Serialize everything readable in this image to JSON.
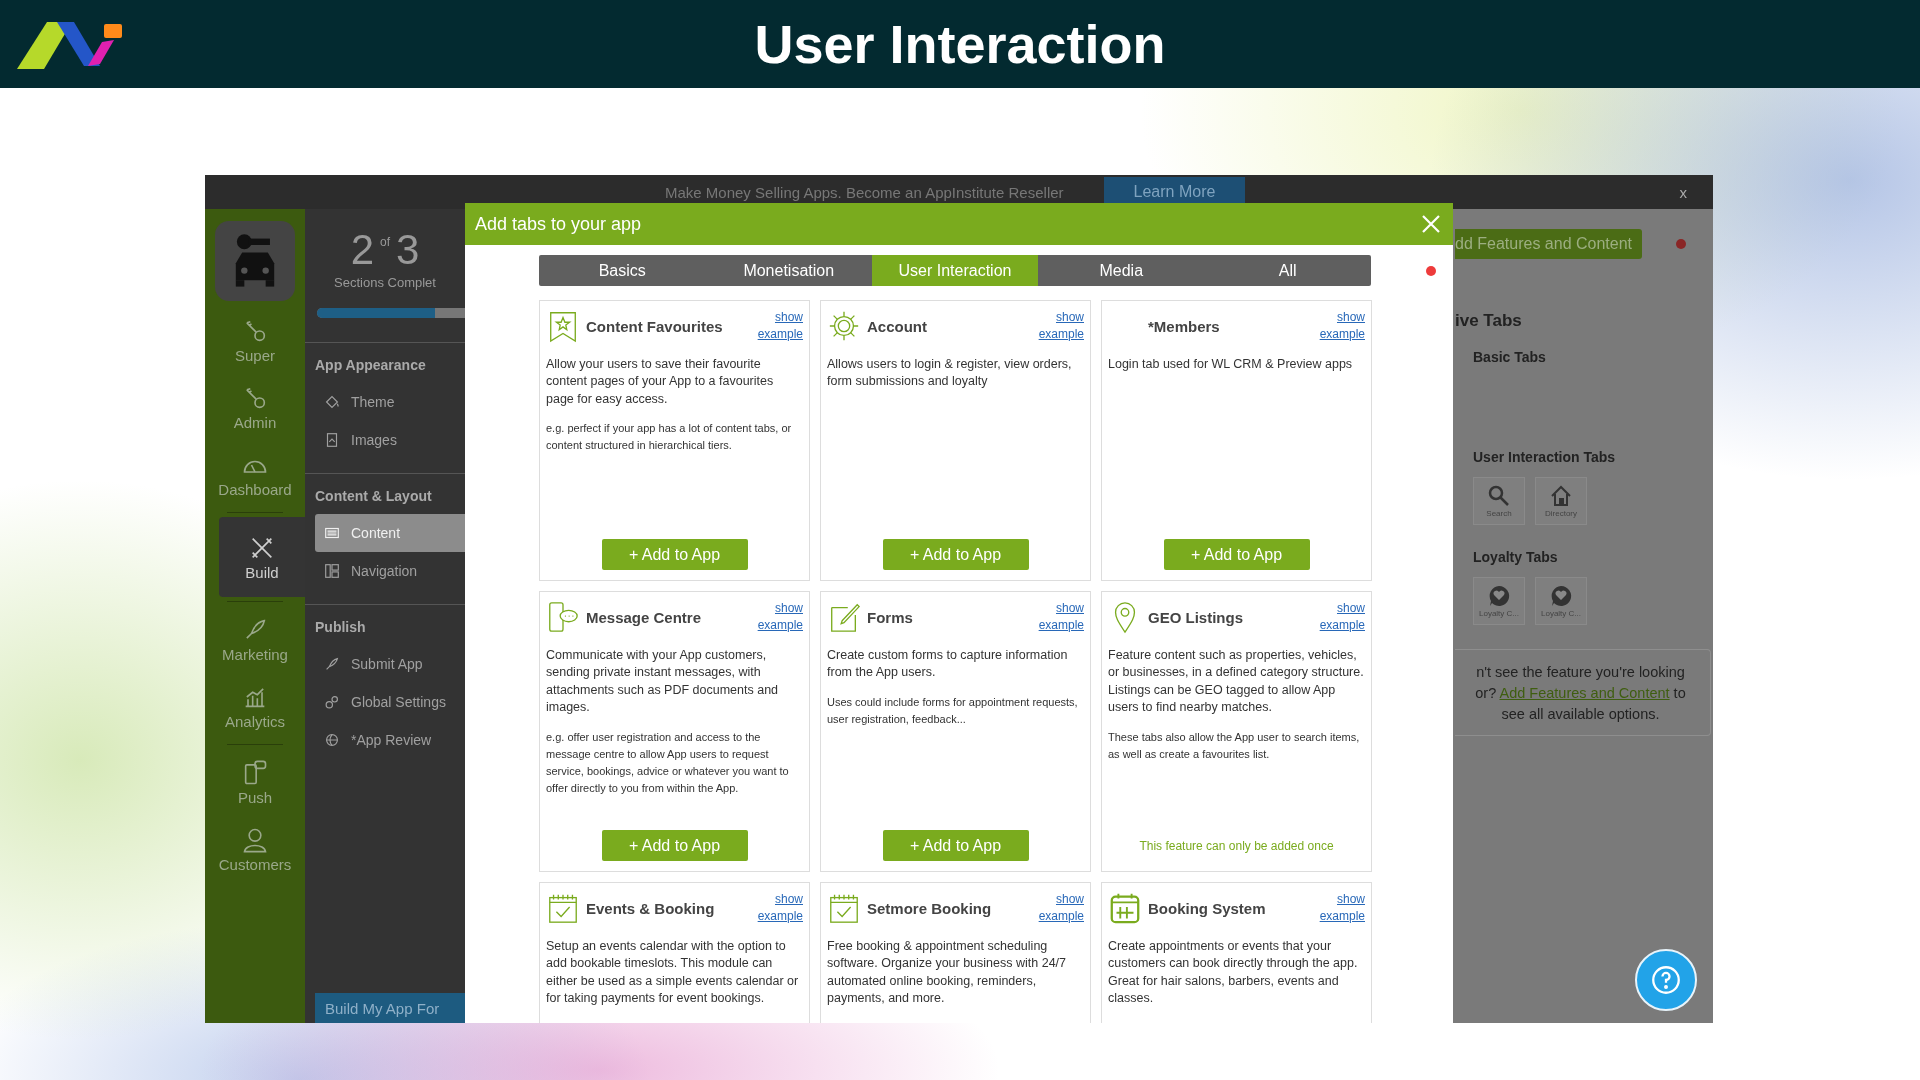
{
  "slide": {
    "title": "User Interaction"
  },
  "banner": {
    "text": "Make Money Selling Apps. Become an AppInstitute Reseller",
    "button": "Learn More",
    "close": "x"
  },
  "rail": {
    "groups": [
      [
        {
          "label": "Super",
          "selected": false
        },
        {
          "label": "Admin",
          "selected": false
        },
        {
          "label": "Dashboard",
          "selected": false
        }
      ],
      [
        {
          "label": "Build",
          "selected": true
        }
      ],
      [
        {
          "label": "Marketing",
          "selected": false
        },
        {
          "label": "Analytics",
          "selected": false
        }
      ],
      [
        {
          "label": "Push",
          "selected": false
        },
        {
          "label": "Customers",
          "selected": false
        }
      ]
    ]
  },
  "progress": {
    "done": "2",
    "of": "of",
    "total": "3",
    "label": "Sections Complet",
    "level": 0.8
  },
  "sections": [
    {
      "title": "App Appearance",
      "items": [
        {
          "label": "Theme",
          "selected": false
        },
        {
          "label": "Images",
          "selected": false
        }
      ]
    },
    {
      "title": "Content & Layout",
      "items": [
        {
          "label": "Content",
          "selected": true
        },
        {
          "label": "Navigation",
          "selected": false
        }
      ]
    },
    {
      "title": "Publish",
      "items": [
        {
          "label": "Submit App",
          "selected": false
        },
        {
          "label": "Global Settings",
          "selected": false
        },
        {
          "label": "*App Review",
          "selected": false
        }
      ]
    }
  ],
  "build_button": "Build My App For",
  "modal": {
    "title": "Add tabs to your app",
    "tabs": [
      {
        "label": "Basics",
        "selected": false
      },
      {
        "label": "Monetisation",
        "selected": false
      },
      {
        "label": "User Interaction",
        "selected": true
      },
      {
        "label": "Media",
        "selected": false
      },
      {
        "label": "All",
        "selected": false
      }
    ],
    "cards": [
      {
        "title": "Content Favourites",
        "link": "show example",
        "paragraphs": [
          {
            "kind": "main",
            "text": "Allow your users to save their favourite content pages of your App to a favourites page for easy access."
          },
          {
            "kind": "note",
            "text": "e.g. perfect if your app has a lot of content tabs, or content structured in hierarchical tiers."
          }
        ],
        "action": {
          "kind": "button",
          "text": "+ Add to App"
        }
      },
      {
        "title": "Account",
        "link": "show example",
        "paragraphs": [
          {
            "kind": "main",
            "text": "Allows users to login & register, view orders, form submissions and loyalty"
          }
        ],
        "action": {
          "kind": "button",
          "text": "+ Add to App"
        }
      },
      {
        "title": "*Members",
        "link": "show example",
        "paragraphs": [
          {
            "kind": "main",
            "text": "Login tab used for WL CRM & Preview apps"
          }
        ],
        "action": {
          "kind": "button",
          "text": "+ Add to App"
        }
      },
      {
        "title": "Message Centre",
        "link": "show example",
        "paragraphs": [
          {
            "kind": "main",
            "text": "Communicate with your App customers, sending private instant messages, with attachments such as PDF documents and images."
          },
          {
            "kind": "note",
            "text": "e.g. offer user registration and access to the message centre to allow App users to request service, bookings, advice or whatever you want to offer directly to you from within the App."
          }
        ],
        "action": {
          "kind": "button",
          "text": "+ Add to App"
        }
      },
      {
        "title": "Forms",
        "link": "show example",
        "paragraphs": [
          {
            "kind": "main",
            "text": "Create custom forms to capture information from the App users."
          },
          {
            "kind": "note",
            "text": "Uses could include forms for appointment requests, user registration, feedback..."
          }
        ],
        "action": {
          "kind": "button",
          "text": "+ Add to App"
        }
      },
      {
        "title": "GEO Listings",
        "link": "show example",
        "paragraphs": [
          {
            "kind": "main",
            "text": "Feature content such as properties, vehicles, or businesses, in a defined category structure. Listings can be GEO tagged to allow App users to find nearby matches."
          },
          {
            "kind": "note",
            "text": "These tabs also allow the App user to search items, as well as create a favourites list."
          }
        ],
        "action": {
          "kind": "notice",
          "text": "This feature can only be added once"
        }
      },
      {
        "title": "Events & Booking",
        "link": "show example",
        "paragraphs": [
          {
            "kind": "main",
            "text": "Setup an events calendar with the option to add bookable timeslots. This module can either be used as a simple events calendar or for taking payments for event bookings."
          }
        ]
      },
      {
        "title": "Setmore Booking",
        "link": "show example",
        "paragraphs": [
          {
            "kind": "main",
            "text": "Free booking & appointment scheduling software. Organize your business with 24/7 automated online booking, reminders, payments, and more."
          }
        ]
      },
      {
        "title": "Booking System",
        "link": "show example",
        "paragraphs": [
          {
            "kind": "main",
            "text": "Create appointments or events that your customers can book directly through the app. Great for hair salons, barbers, events and classes."
          }
        ]
      }
    ]
  },
  "right_panel": {
    "add_button": "dd Features and Content",
    "heading": "ive Tabs",
    "groups": [
      {
        "title": "Basic Tabs"
      },
      {
        "title": "User Interaction Tabs",
        "tiles": [
          {
            "label": "Search"
          },
          {
            "label": "Directory"
          }
        ]
      },
      {
        "title": "Loyalty Tabs",
        "tiles": [
          {
            "label": "Loyalty C..."
          },
          {
            "label": "Loyalty C..."
          }
        ]
      }
    ],
    "hint": {
      "before": "n't see the feature you're looking or?",
      "link": "Add Features and Content",
      "after": "to see all available options."
    }
  }
}
